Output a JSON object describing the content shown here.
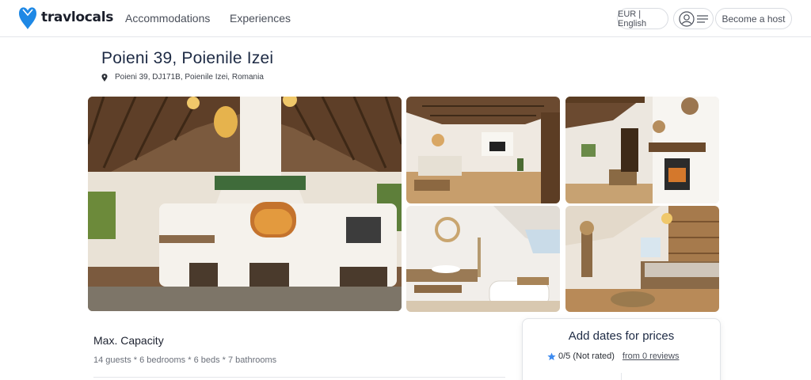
{
  "header": {
    "logo_text": "travlocals",
    "nav": {
      "accommodations": "Accommodations",
      "experiences": "Experiences"
    },
    "language_currency": "EUR | English",
    "become_host": "Become a host",
    "icons": [
      "logo-heart-icon",
      "user-icon",
      "menu-icon"
    ]
  },
  "listing": {
    "title": "Poieni 39, Poienile Izei",
    "address": "Poieni 39, DJ171B, Poienile Izei, Romania",
    "address_icon": "map-pin-icon"
  },
  "gallery": {
    "photos": [
      "outdoor-kitchen-photo",
      "living-room-photo",
      "fireplace-room-photo",
      "bathroom-photo",
      "bedroom-photo"
    ]
  },
  "details": {
    "capacity_heading": "Max. Capacity",
    "capacity_text": "14 guests * 6 bedrooms * 6 beds * 7 bathrooms"
  },
  "booking": {
    "title": "Add dates for prices",
    "rating": "0/5 (Not rated)",
    "reviews_link": "from 0 reviews",
    "star_icon": "star-icon"
  },
  "colors": {
    "brand_blue": "#1e88e5",
    "title_navy": "#1d2a44",
    "star_blue": "#3d8bf0"
  }
}
